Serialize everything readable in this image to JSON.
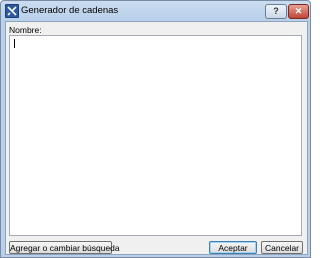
{
  "window": {
    "title": "Generador de cadenas",
    "help_label": "?",
    "close_label": "✕"
  },
  "form": {
    "name_label": "Nombre:",
    "name_value": ""
  },
  "buttons": {
    "search_label": "Agregar o cambiar búsqueda",
    "accept_label": "Aceptar",
    "cancel_label": "Cancelar"
  }
}
